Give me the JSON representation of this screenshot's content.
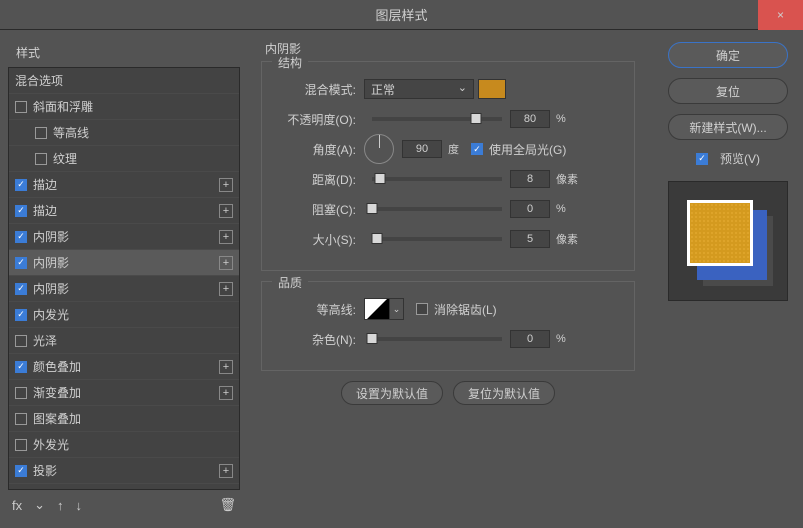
{
  "window": {
    "title": "图层样式",
    "close": "×"
  },
  "sidebar": {
    "styles_label": "样式",
    "blend_options_label": "混合选项",
    "items": [
      {
        "label": "斜面和浮雕",
        "checked": false,
        "plus": false,
        "sub": false
      },
      {
        "label": "等高线",
        "checked": false,
        "plus": false,
        "sub": true
      },
      {
        "label": "纹理",
        "checked": false,
        "plus": false,
        "sub": true
      },
      {
        "label": "描边",
        "checked": true,
        "plus": true,
        "sub": false
      },
      {
        "label": "描边",
        "checked": true,
        "plus": true,
        "sub": false
      },
      {
        "label": "内阴影",
        "checked": true,
        "plus": true,
        "sub": false
      },
      {
        "label": "内阴影",
        "checked": true,
        "plus": true,
        "sub": false,
        "selected": true
      },
      {
        "label": "内阴影",
        "checked": true,
        "plus": true,
        "sub": false
      },
      {
        "label": "内发光",
        "checked": true,
        "plus": false,
        "sub": false
      },
      {
        "label": "光泽",
        "checked": false,
        "plus": false,
        "sub": false
      },
      {
        "label": "颜色叠加",
        "checked": true,
        "plus": true,
        "sub": false
      },
      {
        "label": "渐变叠加",
        "checked": false,
        "plus": true,
        "sub": false
      },
      {
        "label": "图案叠加",
        "checked": false,
        "plus": false,
        "sub": false
      },
      {
        "label": "外发光",
        "checked": false,
        "plus": false,
        "sub": false
      },
      {
        "label": "投影",
        "checked": true,
        "plus": true,
        "sub": false
      }
    ],
    "tools": {
      "fx": "fx",
      "up": "↑",
      "down": "↓",
      "trash": "🗑"
    }
  },
  "center": {
    "panel_title": "内阴影",
    "structure": {
      "title": "结构",
      "blend_mode_label": "混合模式:",
      "blend_mode_value": "正常",
      "color": "#c78a1e",
      "opacity_label": "不透明度(O):",
      "opacity_value": "80",
      "opacity_unit": "%",
      "angle_label": "角度(A):",
      "angle_value": "90",
      "angle_unit": "度",
      "global_light_label": "使用全局光(G)",
      "global_light_checked": true,
      "distance_label": "距离(D):",
      "distance_value": "8",
      "distance_unit": "像素",
      "choke_label": "阻塞(C):",
      "choke_value": "0",
      "choke_unit": "%",
      "size_label": "大小(S):",
      "size_value": "5",
      "size_unit": "像素"
    },
    "quality": {
      "title": "品质",
      "contour_label": "等高线:",
      "antialias_label": "消除锯齿(L)",
      "antialias_checked": false,
      "noise_label": "杂色(N):",
      "noise_value": "0",
      "noise_unit": "%"
    },
    "buttons": {
      "default": "设置为默认值",
      "reset": "复位为默认值"
    }
  },
  "right": {
    "ok": "确定",
    "cancel": "复位",
    "new_style": "新建样式(W)...",
    "preview_label": "预览(V)",
    "preview_checked": true
  }
}
